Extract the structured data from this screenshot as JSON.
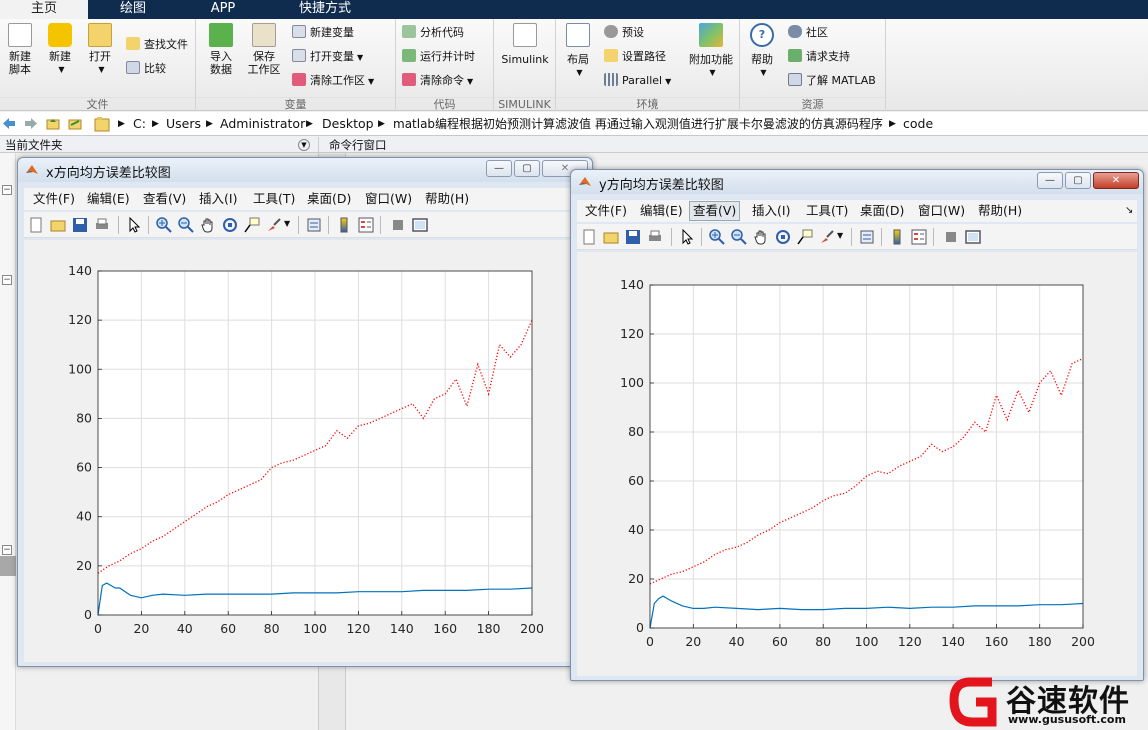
{
  "tabs": [
    {
      "label": "主页"
    },
    {
      "label": "绘图"
    },
    {
      "label": "APP"
    },
    {
      "label": "快捷方式"
    }
  ],
  "ribbon": {
    "file": {
      "label": "文件",
      "new_script": [
        "新建",
        "脚本"
      ],
      "new": "新建",
      "open": "打开",
      "find_files": "查找文件",
      "compare": "比较"
    },
    "variable": {
      "label": "变量",
      "import": [
        "导入",
        "数据"
      ],
      "save": [
        "保存",
        "工作区"
      ],
      "new_var": "新建变量",
      "open_var": "打开变量",
      "clear_ws": "清除工作区"
    },
    "code": {
      "label": "代码",
      "analyze": "分析代码",
      "run_time": "运行并计时",
      "clear_cmd": "清除命令"
    },
    "simulink": {
      "label": "SIMULINK",
      "btn": "Simulink"
    },
    "env": {
      "label": "环境",
      "layout": "布局",
      "prefs": "预设",
      "set_path": "设置路径",
      "parallel": "Parallel",
      "addons": "附加功能"
    },
    "resources": {
      "label": "资源",
      "help": "帮助",
      "community": "社区",
      "support": "请求支持",
      "learn": "了解 MATLAB"
    }
  },
  "address": {
    "segments": [
      "C:",
      "Users",
      "Administrator",
      "Desktop",
      "matlab编程根据初始预测计算滤波值 再通过输入观测值进行扩展卡尔曼滤波的仿真源码程序",
      "code"
    ]
  },
  "panels": {
    "current_folder": "当前文件夹",
    "command_window": "命令行窗口"
  },
  "menu": [
    "文件(F)",
    "编辑(E)",
    "查看(V)",
    "插入(I)",
    "工具(T)",
    "桌面(D)",
    "窗口(W)",
    "帮助(H)"
  ],
  "fig1": {
    "title": "x方向均方误差比较图"
  },
  "fig2": {
    "title": "y方向均方误差比较图"
  },
  "watermark": {
    "name": "谷速软件",
    "url": "www.gususoft.com"
  },
  "colors": {
    "red_series": "#ff0000",
    "blue_series": "#0072bd"
  },
  "chart_data": [
    {
      "type": "line",
      "title": "",
      "xlabel": "",
      "ylabel": "",
      "xlim": [
        0,
        200
      ],
      "ylim": [
        0,
        140
      ],
      "xticks": [
        0,
        20,
        40,
        60,
        80,
        100,
        120,
        140,
        160,
        180,
        200
      ],
      "yticks": [
        0,
        20,
        40,
        60,
        80,
        100,
        120,
        140
      ],
      "grid": true,
      "series": [
        {
          "style": "dotted",
          "color": "#ff0000",
          "x": [
            0,
            5,
            10,
            15,
            20,
            25,
            30,
            35,
            40,
            45,
            50,
            55,
            60,
            65,
            70,
            75,
            80,
            85,
            90,
            95,
            100,
            105,
            110,
            115,
            120,
            125,
            130,
            135,
            140,
            145,
            150,
            155,
            160,
            165,
            170,
            175,
            180,
            185,
            190,
            195,
            200
          ],
          "y": [
            17,
            20,
            22,
            25,
            27,
            30,
            32,
            35,
            38,
            41,
            44,
            46,
            49,
            51,
            53,
            55,
            60,
            62,
            63,
            65,
            67,
            69,
            75,
            72,
            77,
            78,
            80,
            82,
            84,
            86,
            80,
            88,
            90,
            96,
            85,
            102,
            90,
            110,
            105,
            110,
            120
          ]
        },
        {
          "style": "solid",
          "color": "#0072bd",
          "x": [
            0,
            2,
            4,
            6,
            8,
            10,
            15,
            20,
            25,
            30,
            40,
            50,
            60,
            70,
            80,
            90,
            100,
            110,
            120,
            130,
            140,
            150,
            160,
            170,
            180,
            190,
            200
          ],
          "y": [
            0,
            12,
            13,
            12,
            11,
            11,
            8,
            7,
            8,
            8.5,
            8,
            8.5,
            8.5,
            8.5,
            8.5,
            9,
            9,
            9,
            9.5,
            9.5,
            9.5,
            10,
            10,
            10,
            10.5,
            10.5,
            11
          ]
        }
      ]
    },
    {
      "type": "line",
      "title": "",
      "xlabel": "",
      "ylabel": "",
      "xlim": [
        0,
        200
      ],
      "ylim": [
        0,
        140
      ],
      "xticks": [
        0,
        20,
        40,
        60,
        80,
        100,
        120,
        140,
        160,
        180,
        200
      ],
      "yticks": [
        0,
        20,
        40,
        60,
        80,
        100,
        120,
        140
      ],
      "grid": true,
      "series": [
        {
          "style": "dotted",
          "color": "#ff0000",
          "x": [
            0,
            5,
            10,
            15,
            20,
            25,
            30,
            35,
            40,
            45,
            50,
            55,
            60,
            65,
            70,
            75,
            80,
            85,
            90,
            95,
            100,
            105,
            110,
            115,
            120,
            125,
            130,
            135,
            140,
            145,
            150,
            155,
            160,
            165,
            170,
            175,
            180,
            185,
            190,
            195,
            200
          ],
          "y": [
            18,
            20,
            22,
            23,
            25,
            27,
            30,
            32,
            33,
            35,
            38,
            40,
            43,
            45,
            47,
            49,
            52,
            54,
            55,
            58,
            62,
            64,
            63,
            66,
            68,
            70,
            75,
            72,
            74,
            78,
            84,
            80,
            95,
            85,
            97,
            88,
            100,
            105,
            95,
            108,
            110
          ]
        },
        {
          "style": "solid",
          "color": "#0072bd",
          "x": [
            0,
            2,
            4,
            6,
            8,
            10,
            15,
            20,
            25,
            30,
            40,
            50,
            60,
            70,
            80,
            90,
            100,
            110,
            120,
            130,
            140,
            150,
            160,
            170,
            180,
            190,
            200
          ],
          "y": [
            0,
            10,
            12,
            13,
            12,
            11,
            9,
            8,
            8,
            8.5,
            8,
            7.5,
            8,
            7.5,
            7.5,
            8,
            8,
            8.5,
            8,
            8.5,
            8.5,
            9,
            9,
            9,
            9.5,
            9.5,
            10
          ]
        }
      ]
    }
  ]
}
